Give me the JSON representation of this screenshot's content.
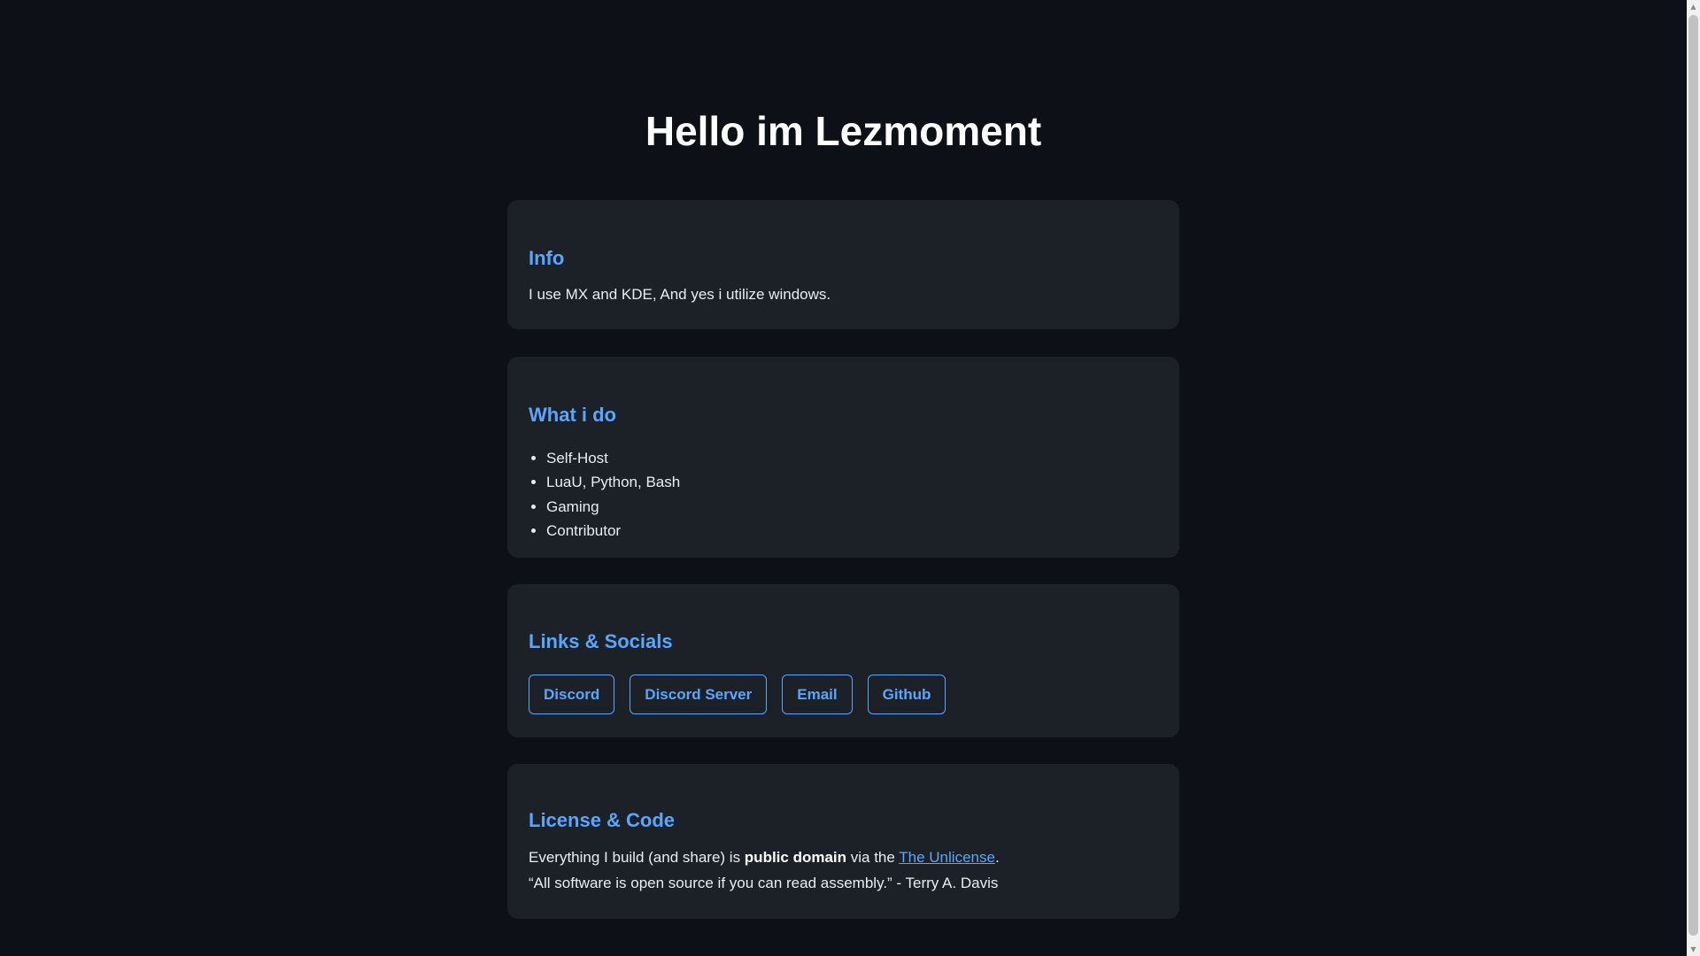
{
  "header": {
    "title": "Hello im Lezmoment"
  },
  "info": {
    "heading": "Info",
    "text": "I use MX and KDE, And yes i utilize windows."
  },
  "what_i_do": {
    "heading": "What i do",
    "items": [
      "Self-Host",
      "LuaU, Python, Bash",
      "Gaming",
      "Contributor"
    ]
  },
  "links": {
    "heading": "Links & Socials",
    "buttons": [
      "Discord",
      "Discord Server",
      "Email",
      "Github"
    ]
  },
  "license": {
    "heading": "License & Code",
    "line1_prefix": "Everything I build (and share) is ",
    "line1_bold": "public domain",
    "line1_mid": " via the ",
    "line1_link": "The Unlicense",
    "line1_suffix": ".",
    "quote": "“All software is open source if you can read assembly.” - Terry A. Davis"
  },
  "colors": {
    "background": "#0d1117",
    "card": "#1c2128",
    "accent": "#58a6ff"
  },
  "icons": {
    "scroll_up": "triangle-up-icon",
    "scroll_down": "triangle-down-icon"
  }
}
